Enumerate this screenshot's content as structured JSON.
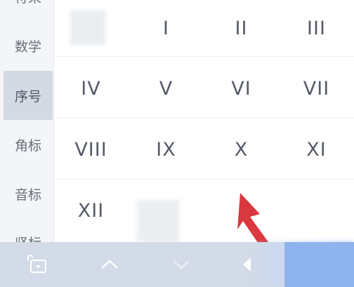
{
  "sidebar": {
    "items": [
      {
        "label": "符采"
      },
      {
        "label": "数学"
      },
      {
        "label": "序号",
        "active": true
      },
      {
        "label": "角标"
      },
      {
        "label": "音标"
      },
      {
        "label": "竖标"
      }
    ]
  },
  "keypad": {
    "rows": [
      [
        "I",
        "II",
        "III"
      ],
      [
        "IV",
        "V",
        "VI",
        "VII"
      ],
      [
        "VIII",
        "IX",
        "X",
        "XI"
      ],
      [
        "XII"
      ]
    ]
  },
  "toolbar": {
    "lock_icon": "lock-keyboard-icon",
    "up_icon": "chevron-up-icon",
    "down_icon": "chevron-down-icon",
    "delete_icon": "backspace-icon"
  },
  "colors": {
    "active_tab": "#d3dae4",
    "toolbar": "#d2dbe7",
    "confirm": "#8fb3ec",
    "pointer": "#d9383f"
  }
}
